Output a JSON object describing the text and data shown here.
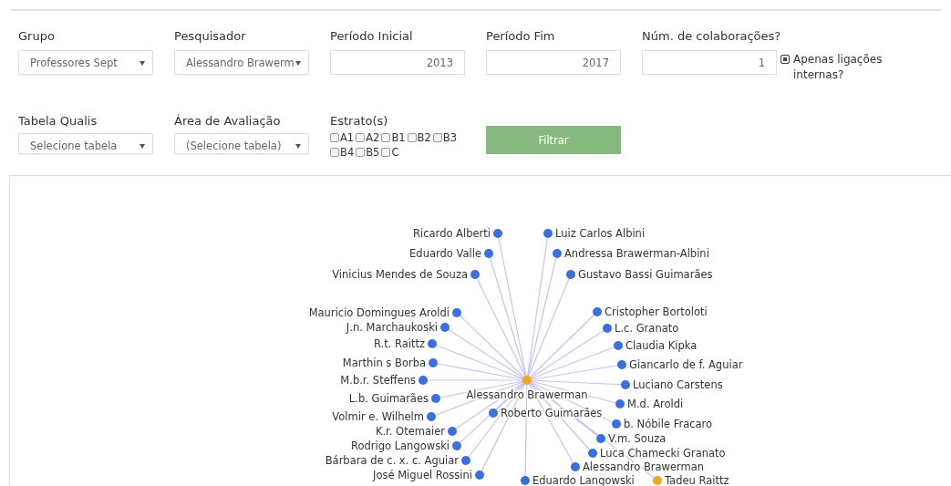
{
  "top_filters": [
    {
      "label": "Grupo",
      "kind": "select",
      "value": "Professores Sept"
    },
    {
      "label": "Pesquisador",
      "kind": "select",
      "value": "Alessandro Brawerm"
    },
    {
      "label": "Período Inicial",
      "kind": "input",
      "value": "2013"
    },
    {
      "label": "Período Fim",
      "kind": "input",
      "value": "2017"
    },
    {
      "label": "Núm. de colaborações?",
      "kind": "input",
      "value": "1"
    }
  ],
  "internal_only": {
    "label": "Apenas ligações internas?",
    "checked": true
  },
  "bottom_filters": [
    {
      "label": "Tabela Qualis",
      "kind": "select",
      "value": "Selecione tabela"
    },
    {
      "label": "Área de Avaliação",
      "kind": "select",
      "value": "(Selecione tabela)"
    }
  ],
  "strata": {
    "label": "Estrato(s)",
    "options": [
      {
        "label": "A1",
        "checked": false
      },
      {
        "label": "A2",
        "checked": false
      },
      {
        "label": "B1",
        "checked": false
      },
      {
        "label": "B2",
        "checked": false
      },
      {
        "label": "B3",
        "checked": false
      },
      {
        "label": "B4",
        "checked": false
      },
      {
        "label": "B5",
        "checked": false
      },
      {
        "label": "C",
        "checked": false
      }
    ]
  },
  "filter_button": "Filtrar",
  "graph": {
    "center": {
      "label": "Alessandro Brawerman",
      "color": "#f5a623"
    },
    "nodes": [
      {
        "label": "Ricardo Alberti",
        "color": "#3b6fe0"
      },
      {
        "label": "Luiz Carlos Albini",
        "color": "#3b6fe0"
      },
      {
        "label": "Eduardo Valle",
        "color": "#3b6fe0"
      },
      {
        "label": "Andressa Brawerman-Albini",
        "color": "#3b6fe0"
      },
      {
        "label": "Vinicius Mendes de Souza",
        "color": "#3b6fe0"
      },
      {
        "label": "Gustavo Bassi Guimarães",
        "color": "#3b6fe0"
      },
      {
        "label": "Mauricio Domingues Aroldi",
        "color": "#3b6fe0"
      },
      {
        "label": "Cristopher Bortoloti",
        "color": "#3b6fe0"
      },
      {
        "label": "J.n. Marchaukoski",
        "color": "#3b6fe0"
      },
      {
        "label": "L.c. Granato",
        "color": "#3b6fe0"
      },
      {
        "label": "R.t. Raittz",
        "color": "#3b6fe0"
      },
      {
        "label": "Claudia Kipka",
        "color": "#3b6fe0"
      },
      {
        "label": "Marthin s Borba",
        "color": "#3b6fe0"
      },
      {
        "label": "Giancarlo de f. Aguiar",
        "color": "#3b6fe0"
      },
      {
        "label": "M.b.r. Steffens",
        "color": "#3b6fe0"
      },
      {
        "label": "Luciano Carstens",
        "color": "#3b6fe0"
      },
      {
        "label": "L.b. Guimarães",
        "color": "#3b6fe0"
      },
      {
        "label": "M.d. Aroldi",
        "color": "#3b6fe0"
      },
      {
        "label": "Volmir e. Wilhelm",
        "color": "#3b6fe0"
      },
      {
        "label": "b. Nóbile Fracaro",
        "color": "#3b6fe0"
      },
      {
        "label": "K.r. Otemaier",
        "color": "#3b6fe0"
      },
      {
        "label": "V.m. Souza",
        "color": "#3b6fe0"
      },
      {
        "label": "Rodrigo Langowski",
        "color": "#3b6fe0"
      },
      {
        "label": "Bárbara de c. x. c. Aguiar",
        "color": "#3b6fe0"
      },
      {
        "label": "Luca Chamecki Granato",
        "color": "#3b6fe0"
      },
      {
        "label": "Alessandro Brawerman",
        "color": "#3b6fe0"
      },
      {
        "label": "José Miguel Rossini",
        "color": "#3b6fe0"
      },
      {
        "label": "Roberto Guimarães",
        "color": "#3b6fe0"
      },
      {
        "label": "Eduardo Langowski",
        "color": "#3b6fe0"
      },
      {
        "label": "Tadeu Raittz",
        "color": "#f5a623"
      }
    ]
  }
}
